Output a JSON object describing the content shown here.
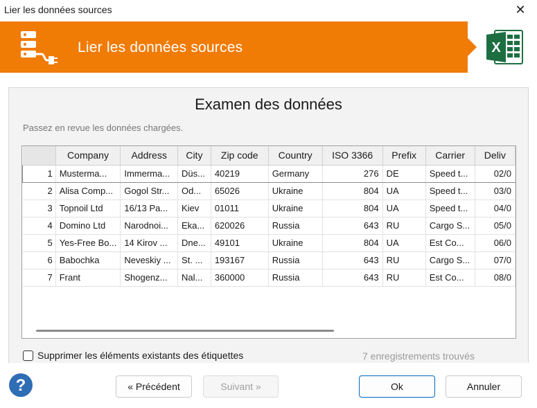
{
  "window": {
    "title": "Lier les données sources",
    "close_glyph": "✕"
  },
  "banner": {
    "title": "Lier les données sources",
    "logo_icon": "database-plug-icon",
    "excel_icon": "excel-icon",
    "color": "#f07b05"
  },
  "main": {
    "heading": "Examen des données",
    "subheading": "Passez en revue les données chargées."
  },
  "grid": {
    "columns": [
      "",
      "Company",
      "Address",
      "City",
      "Zip code",
      "Country",
      "ISO 3366",
      "Prefix",
      "Carrier",
      "Deliv"
    ],
    "rows": [
      [
        "1",
        "Musterma...",
        "Immerma...",
        "Düs...",
        "40219",
        "Germany",
        "276",
        "DE",
        "Speed t...",
        "02/0"
      ],
      [
        "2",
        "Alisa Comp...",
        "Gogol Str...",
        "Od...",
        "65026",
        "Ukraine",
        "804",
        "UA",
        "Speed t...",
        "03/0"
      ],
      [
        "3",
        "Topnoil Ltd",
        "16/13 Pa...",
        "Kiev",
        "01011",
        "Ukraine",
        "804",
        "UA",
        "Speed t...",
        "04/0"
      ],
      [
        "4",
        "Domino Ltd",
        "Narodnoi...",
        "Eka...",
        "620026",
        "Russia",
        "643",
        "RU",
        "Cargo S...",
        "05/0"
      ],
      [
        "5",
        "Yes-Free Bo...",
        "14 Kirov ...",
        "Dne...",
        "49101",
        "Ukraine",
        "804",
        "UA",
        "Est Co...",
        "06/0"
      ],
      [
        "6",
        "Babochka",
        "Neveskiy ...",
        "St. ...",
        "193167",
        "Russia",
        "643",
        "RU",
        "Cargo S...",
        "07/0"
      ],
      [
        "7",
        "Frant",
        "Shogenz...",
        "Nal...",
        "360000",
        "Russia",
        "643",
        "RU",
        "Est Co...",
        "08/0"
      ]
    ]
  },
  "options": {
    "remove_existing_label": "Supprimer les éléments existants des étiquettes",
    "remove_existing_checked": false
  },
  "status": {
    "records_found": "7 enregistrements trouvés"
  },
  "buttons": {
    "previous": "« Précédent",
    "next": "Suivant »",
    "ok": "Ok",
    "cancel": "Annuler"
  },
  "help": {
    "glyph": "?"
  }
}
